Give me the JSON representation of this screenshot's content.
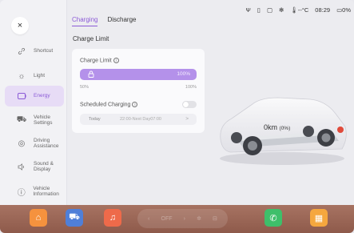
{
  "sidebar": {
    "close_icon": "×",
    "items": [
      {
        "label": "Shortcut",
        "icon": "link-icon",
        "glyph": "🔗"
      },
      {
        "label": "Light",
        "icon": "light-icon",
        "glyph": "☼"
      },
      {
        "label": "Energy",
        "icon": "battery-icon",
        "glyph": "▭",
        "active": true
      },
      {
        "label": "Vehicle Settings",
        "icon": "car-icon",
        "glyph": "⛟"
      },
      {
        "label": "Driving Assistance",
        "icon": "steering-icon",
        "glyph": "◎"
      },
      {
        "label": "Sound & Display",
        "icon": "speaker-icon",
        "glyph": "🔊"
      },
      {
        "label": "Vehicle Information",
        "icon": "info-icon",
        "glyph": "ⓘ"
      }
    ]
  },
  "status_bar": {
    "icons": [
      "usb-icon",
      "sim-icon",
      "screen-icon",
      "bluetooth-icon"
    ],
    "glyphs": [
      "Ψ",
      "▯",
      "▢",
      "✻"
    ],
    "temperature": "--°C",
    "time": "08:29",
    "battery": "0%"
  },
  "tabs": [
    {
      "label": "Charging",
      "active": true
    },
    {
      "label": "Discharge",
      "active": false
    }
  ],
  "section_title": "Charge Limit",
  "charge_card": {
    "label": "Charge Limit",
    "info_glyph": "i",
    "slider_value": "100%",
    "min_label": "50%",
    "max_label": "100%",
    "lock_glyph": "🔒",
    "scheduled_label": "Scheduled Charging",
    "scheduled_on": false,
    "schedule_day": "Today",
    "schedule_time": "22:00-Next Day07:00",
    "chevron": ">"
  },
  "vehicle": {
    "range": "0km",
    "range_pct": "(0%)"
  },
  "dock": {
    "apps": [
      {
        "name": "home-icon",
        "glyph": "⌂",
        "color": "#f5923e"
      },
      {
        "name": "car-app-icon",
        "glyph": "⛟",
        "color": "#4f7fd8"
      },
      {
        "name": "music-icon",
        "glyph": "♫",
        "color": "#ee6a4a"
      },
      {
        "name": "phone-icon",
        "glyph": "✆",
        "color": "#3ebf6a"
      },
      {
        "name": "apps-grid-icon",
        "glyph": "▦",
        "color": "#f5a73e"
      }
    ],
    "climate": {
      "left_chevron": "‹",
      "state": "OFF",
      "right_chevron": "›",
      "fan_glyph": "✲",
      "seat_glyph": "⊟"
    }
  }
}
